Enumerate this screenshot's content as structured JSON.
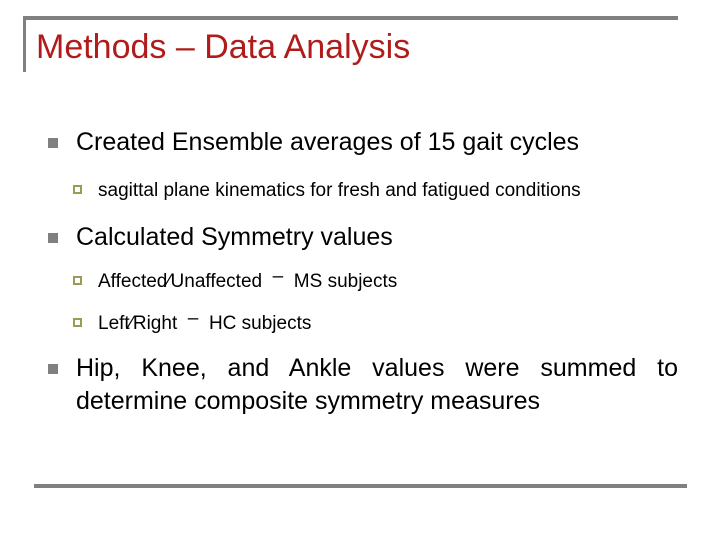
{
  "slide": {
    "title": "Methods – Data Analysis",
    "title_color": "#B01B1B",
    "rule_color": "#808080",
    "background": "#ffffff",
    "bullet_level1_color": "#808080",
    "bullet_level2_color": "#9B9B55",
    "body_text_color": "#000000"
  },
  "content": {
    "items": [
      {
        "level": 1,
        "text": "Created  Ensemble  averages  of  15  gait cycles"
      },
      {
        "level": 2,
        "text": "sagittal  plane  kinematics  for  fresh  and fatigued  conditions"
      },
      {
        "level": 1,
        "text": "Calculated  Symmetry  values"
      },
      {
        "level": 2,
        "text_before_dash": "Affected⁄Unaffected",
        "dash": "‒",
        "text_after_dash": "MS  subjects"
      },
      {
        "level": 2,
        "text_before_dash": "Left⁄Right",
        "dash": "‒",
        "text_after_dash": "HC  subjects"
      },
      {
        "level": 1,
        "text": "Hip,  Knee,  and  Ankle  values  were summed  to  determine  composite symmetry  measures"
      }
    ]
  }
}
